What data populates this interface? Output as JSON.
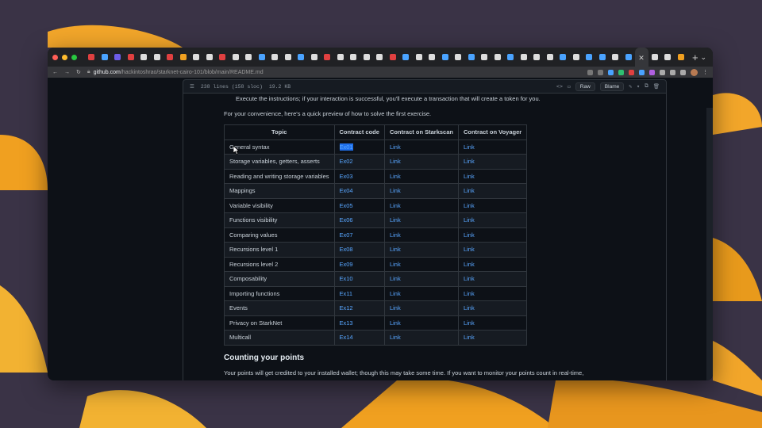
{
  "browser": {
    "url_host": "github.com",
    "url_path": "/hackintoshrao/starknet-cairo-101/blob/main/README.md",
    "tab_count": 47
  },
  "file_header": {
    "lines": "238 lines (158 sloc)",
    "size": "19.2 KB",
    "raw_label": "Raw",
    "blame_label": "Blame"
  },
  "readme": {
    "clipped_line": "Execute the instructions; if your interaction is successful, you'll execute a transaction that will create a token for you.",
    "intro": "For your convenience, here's a quick preview of how to solve the first exercise.",
    "table": {
      "headers": [
        "Topic",
        "Contract code",
        "Contract on Starkscan",
        "Contract on Voyager"
      ],
      "rows": [
        [
          "General syntax",
          "Ex01",
          "Link",
          "Link"
        ],
        [
          "Storage variables, getters, asserts",
          "Ex02",
          "Link",
          "Link"
        ],
        [
          "Reading and writing storage variables",
          "Ex03",
          "Link",
          "Link"
        ],
        [
          "Mappings",
          "Ex04",
          "Link",
          "Link"
        ],
        [
          "Variable visibility",
          "Ex05",
          "Link",
          "Link"
        ],
        [
          "Functions visibility",
          "Ex06",
          "Link",
          "Link"
        ],
        [
          "Comparing values",
          "Ex07",
          "Link",
          "Link"
        ],
        [
          "Recursions level 1",
          "Ex08",
          "Link",
          "Link"
        ],
        [
          "Recursions level 2",
          "Ex09",
          "Link",
          "Link"
        ],
        [
          "Composability",
          "Ex10",
          "Link",
          "Link"
        ],
        [
          "Importing functions",
          "Ex11",
          "Link",
          "Link"
        ],
        [
          "Events",
          "Ex12",
          "Link",
          "Link"
        ],
        [
          "Privacy on StarkNet",
          "Ex13",
          "Link",
          "Link"
        ],
        [
          "Multicall",
          "Ex14",
          "Link",
          "Link"
        ]
      ]
    },
    "section_heading": "Counting your points",
    "section_text": "Your points will get credited to your installed wallet; though this may take some time. If you want to monitor your points count in real-time,"
  },
  "colors": {
    "link": "#58a6ff",
    "background": "#0d1117",
    "desktop": "#3a3346",
    "leaf_orange": "#f0a020"
  }
}
